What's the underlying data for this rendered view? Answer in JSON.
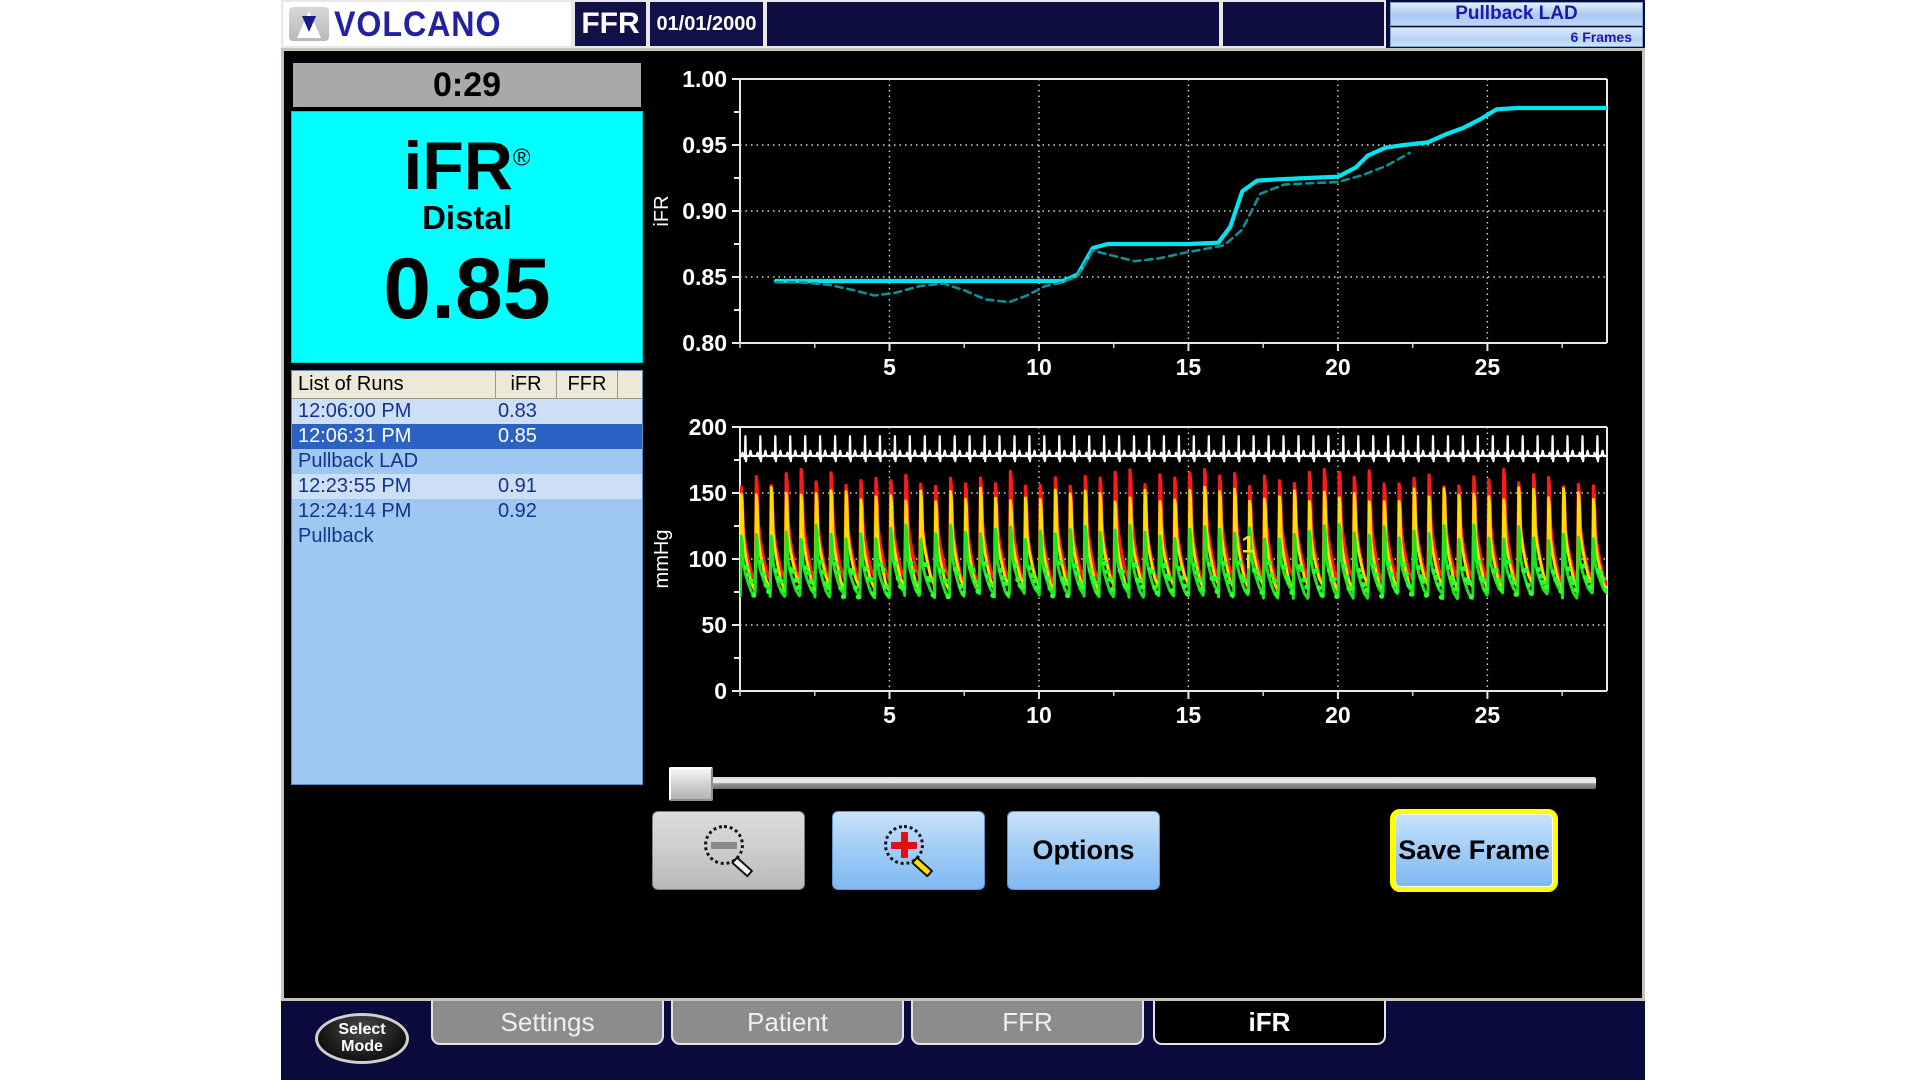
{
  "header": {
    "logo_text": "VOLCANO",
    "logo_icon": "volcano-triangle-icon",
    "mode_label": "FFR",
    "date": "01/01/2000",
    "pullback_title": "Pullback LAD",
    "pullback_frames": "6 Frames"
  },
  "left_panel": {
    "timer": "0:29",
    "measurement": {
      "name": "iFR",
      "registered_mark": "®",
      "location": "Distal",
      "value": "0.85",
      "bg_color": "#00ffff"
    },
    "runs_table": {
      "columns": [
        "List of Runs",
        "iFR",
        "FFR"
      ],
      "rows": [
        {
          "label": "12:06:00 PM",
          "ifr": "0.83",
          "ffr": "",
          "selected": false,
          "alt": true
        },
        {
          "label": "12:06:31 PM",
          "ifr": "0.85",
          "ffr": "",
          "selected": true,
          "alt": false
        },
        {
          "label": "Pullback LAD",
          "ifr": "",
          "ffr": "",
          "selected": false,
          "alt": false
        },
        {
          "label": "12:23:55 PM",
          "ifr": "0.91",
          "ffr": "",
          "selected": false,
          "alt": true
        },
        {
          "label": "12:24:14 PM",
          "ifr": "0.92",
          "ffr": "",
          "selected": false,
          "alt": false
        },
        {
          "label": "Pullback",
          "ifr": "",
          "ffr": "",
          "selected": false,
          "alt": false
        }
      ]
    }
  },
  "buttons": {
    "zoom_out": "",
    "zoom_out_icon": "magnifier-minus-icon",
    "zoom_in": "",
    "zoom_in_icon": "magnifier-plus-icon",
    "options": "Options",
    "save_frame": "Save Frame"
  },
  "slider": {
    "position_percent": 1
  },
  "tabs": {
    "select_mode_line1": "Select",
    "select_mode_line2": "Mode",
    "items": [
      {
        "label": "Settings",
        "active": false
      },
      {
        "label": "Patient",
        "active": false
      },
      {
        "label": "FFR",
        "active": false
      },
      {
        "label": "iFR",
        "active": true
      }
    ]
  },
  "chart_data": [
    {
      "id": "ifr-pullback-chart",
      "type": "line",
      "title": "",
      "xlabel": "",
      "ylabel": "iFR",
      "xlim": [
        0,
        29
      ],
      "ylim": [
        0.8,
        1.0
      ],
      "xticks": [
        5,
        10,
        15,
        20,
        25
      ],
      "xtick_labels": [
        "5",
        "10",
        "15",
        "20",
        "25"
      ],
      "yticks": [
        0.8,
        0.85,
        0.9,
        0.95,
        1.0
      ],
      "ytick_labels": [
        "0.80",
        "0.85",
        "0.90",
        "0.95",
        "1.00"
      ],
      "minor_yticks": [
        0.825,
        0.875,
        0.925,
        0.975
      ],
      "grid": true,
      "background": "#000000",
      "series": [
        {
          "name": "iFR smoothed",
          "color": "#00e5ee",
          "style": "solid",
          "x": [
            1.2,
            2.0,
            3.0,
            4.0,
            5.0,
            6.0,
            7.0,
            8.0,
            9.0,
            10.0,
            10.8,
            11.3,
            11.8,
            12.3,
            13.0,
            14.0,
            15.0,
            16.0,
            16.4,
            16.8,
            17.3,
            18.0,
            19.0,
            20.0,
            20.6,
            21.0,
            21.6,
            22.2,
            23.0,
            23.6,
            24.2,
            24.8,
            25.3,
            26.0,
            27.0,
            28.0,
            29.0
          ],
          "y": [
            0.847,
            0.847,
            0.847,
            0.847,
            0.847,
            0.847,
            0.847,
            0.847,
            0.847,
            0.847,
            0.847,
            0.852,
            0.872,
            0.875,
            0.875,
            0.875,
            0.875,
            0.876,
            0.888,
            0.915,
            0.923,
            0.924,
            0.925,
            0.926,
            0.933,
            0.942,
            0.948,
            0.95,
            0.952,
            0.958,
            0.963,
            0.97,
            0.977,
            0.978,
            0.978,
            0.978,
            0.978
          ]
        },
        {
          "name": "iFR raw",
          "color": "#0d8f96",
          "style": "dashed",
          "x": [
            1.2,
            2.0,
            3.0,
            3.8,
            4.5,
            5.2,
            6.0,
            6.8,
            7.5,
            8.2,
            9.0,
            9.6,
            10.2,
            10.8,
            11.3,
            11.8,
            12.5,
            13.2,
            14.0,
            14.8,
            15.5,
            16.2,
            16.8,
            17.4,
            18.2,
            19.0,
            20.0,
            20.8,
            21.6,
            22.4
          ],
          "y": [
            0.846,
            0.846,
            0.844,
            0.84,
            0.836,
            0.838,
            0.843,
            0.845,
            0.84,
            0.833,
            0.831,
            0.836,
            0.843,
            0.846,
            0.851,
            0.87,
            0.866,
            0.862,
            0.864,
            0.868,
            0.871,
            0.874,
            0.886,
            0.913,
            0.92,
            0.921,
            0.922,
            0.927,
            0.934,
            0.944
          ]
        }
      ]
    },
    {
      "id": "pressure-waveform-chart",
      "type": "line",
      "title": "",
      "xlabel": "",
      "ylabel": "mmHg",
      "xlim": [
        0,
        29
      ],
      "ylim": [
        0,
        200
      ],
      "xticks": [
        5,
        10,
        15,
        20,
        25
      ],
      "xtick_labels": [
        "5",
        "10",
        "15",
        "20",
        "25"
      ],
      "yticks": [
        0,
        50,
        100,
        150,
        200
      ],
      "ytick_labels": [
        "0",
        "50",
        "100",
        "150",
        "200"
      ],
      "minor_yticks": [
        25,
        75,
        125,
        175
      ],
      "grid": true,
      "background": "#000000",
      "annotations": [
        {
          "text": "1",
          "x": 17.0,
          "y": 105,
          "color": "#ffe000"
        }
      ],
      "series": [
        {
          "name": "ECG",
          "color": "#ffffff",
          "style": "solid",
          "baseline_mmhg": 178,
          "beats": 58,
          "description": "ECG rhythm strip across top of plot"
        },
        {
          "name": "Pa (aortic)",
          "color": "#ff1a1a",
          "style": "solid",
          "systolic_mmhg": 162,
          "diastolic_mmhg": 82,
          "beats": 58
        },
        {
          "name": "Pa envelope",
          "color": "#ffdd00",
          "style": "solid",
          "systolic_mmhg": 150,
          "diastolic_mmhg": 78,
          "beats": 58
        },
        {
          "name": "Pd (distal)",
          "color": "#22e022",
          "style": "solid",
          "systolic_mmhg": 120,
          "diastolic_mmhg": 72,
          "beats": 58
        }
      ]
    }
  ]
}
